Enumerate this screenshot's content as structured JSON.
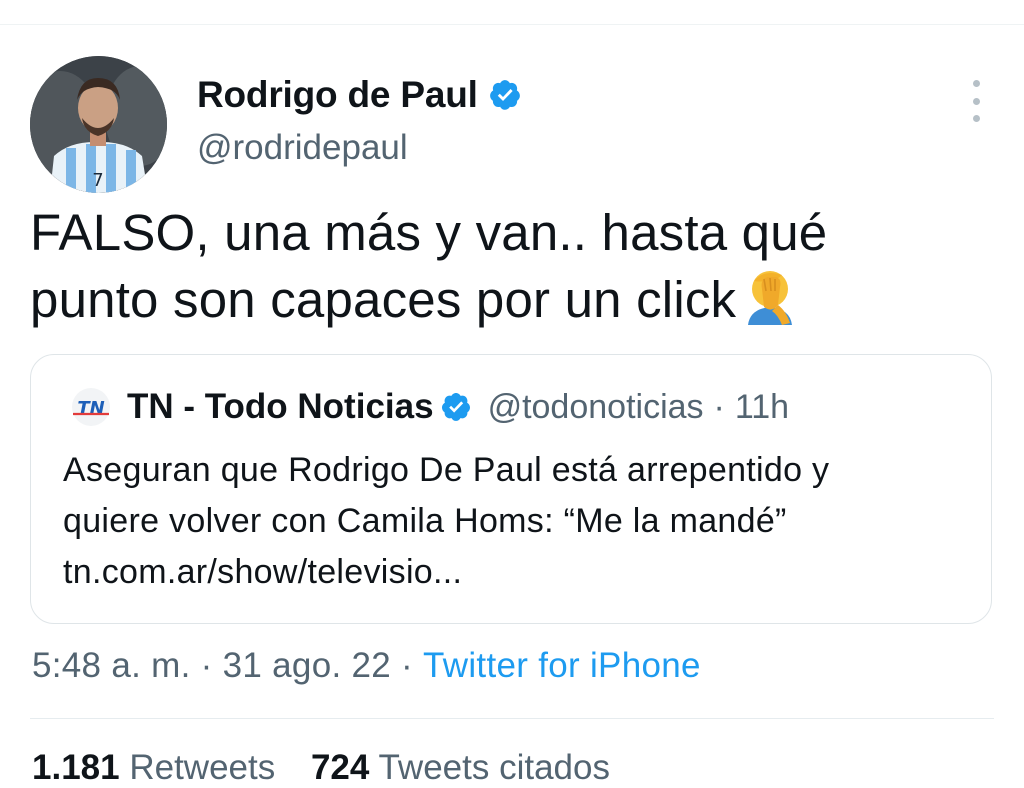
{
  "tweet": {
    "author": {
      "display_name": "Rodrigo de Paul",
      "handle": "@rodridepaul",
      "verified": true
    },
    "text_line1": "FALSO, una más y van.. hasta qué",
    "text_line2": "punto son capaces por un click",
    "emoji": "facepalm-emoji",
    "quote": {
      "display_name": "TN - Todo Noticias",
      "handle": "@todonoticias",
      "separator": "·",
      "time": "11h",
      "text_lines": [
        "Aseguran que Rodrigo De Paul está arrepentido y",
        "quiere volver con Camila Homs: “Me la mandé”",
        "tn.com.ar/show/televisio..."
      ]
    },
    "meta": {
      "time": "5:48 a. m.",
      "sep1": "·",
      "date": "31 ago. 22",
      "sep2": "·",
      "source": "Twitter for iPhone"
    },
    "stats": {
      "retweets_count": "1.181",
      "retweets_label": "Retweets",
      "quotes_count": "724",
      "quotes_label": "Tweets citados"
    }
  },
  "colors": {
    "accent": "#1d9bf0",
    "secondary_text": "#536471",
    "primary_text": "#0f1419",
    "border": "#dfe5e8"
  }
}
